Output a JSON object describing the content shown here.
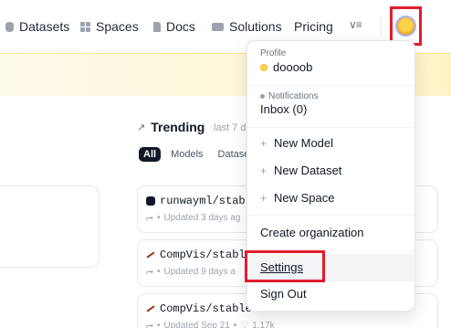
{
  "nav": {
    "items": [
      {
        "label": "Datasets",
        "icon": "datasets-icon"
      },
      {
        "label": "Spaces",
        "icon": "spaces-icon"
      },
      {
        "label": "Docs",
        "icon": "docs-icon"
      },
      {
        "label": "Solutions",
        "icon": "solutions-icon"
      },
      {
        "label": "Pricing",
        "icon": ""
      }
    ],
    "more_icon": "≡"
  },
  "trending": {
    "title": "Trending",
    "subtitle": "last 7 d",
    "filters": [
      "All",
      "Models",
      "Datase"
    ]
  },
  "repos": [
    {
      "name": "runwayml/stabl",
      "meta": "Updated 3 days ag"
    },
    {
      "name": "CompVis/stable",
      "meta": "Updated 9 days a"
    },
    {
      "name": "CompVis/stable",
      "meta": "Updated Sep 21",
      "likes": "1.17k"
    }
  ],
  "menu": {
    "profile_label": "Profile",
    "username": "doooob",
    "notifications_label": "Notifications",
    "inbox": "Inbox (0)",
    "new_model": "New Model",
    "new_dataset": "New Dataset",
    "new_space": "New Space",
    "create_org": "Create organization",
    "settings": "Settings",
    "sign_out": "Sign Out"
  },
  "colors": {
    "highlight_box": "#e11d2e",
    "banner": "#fef3c7"
  }
}
